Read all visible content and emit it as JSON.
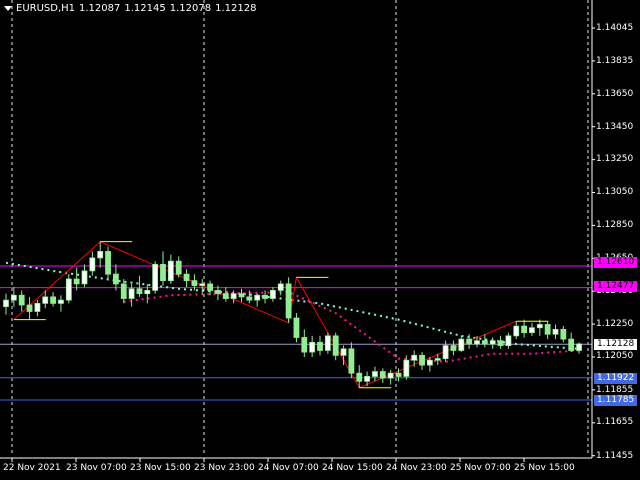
{
  "header": {
    "symbol": "EURUSD,H1",
    "open": "1.12087",
    "high": "1.12145",
    "low": "1.12078",
    "close": "1.12128"
  },
  "price_scale": [
    "1.14045",
    "1.13835",
    "1.13650",
    "1.13450",
    "1.13250",
    "1.13050",
    "1.12850",
    "1.12650",
    "1.12450",
    "1.12250",
    "1.12050",
    "1.11855",
    "1.11655",
    "1.11455"
  ],
  "time_scale": [
    "22 Nov 2021",
    "23 Nov 07:00",
    "23 Nov 15:00",
    "23 Nov 23:00",
    "24 Nov 07:00",
    "24 Nov 15:00",
    "24 Nov 23:00",
    "25 Nov 07:00",
    "25 Nov 15:00"
  ],
  "price_tags": [
    {
      "label": "1.12610",
      "bg": "#ff00ff",
      "fg": "#000000"
    },
    {
      "label": "1.12477",
      "bg": "#ff00ff",
      "fg": "#000000"
    },
    {
      "label": "1.12128",
      "bg": "#ffffff",
      "fg": "#000000"
    },
    {
      "label": "1.11922",
      "bg": "#4169e1",
      "fg": "#ffffff"
    },
    {
      "label": "1.11785",
      "bg": "#4169e1",
      "fg": "#ffffff"
    }
  ],
  "colors": {
    "bull": "#ffffff",
    "bear": "#90ee90",
    "candle_outline": "#90ee90",
    "zigzag": "#ff0000",
    "swing_level": "#ffff00",
    "ma_upper": "#7fffd4",
    "ma_lower": "#ff1493",
    "magenta_line": "#ff00ff",
    "blue_line": "#4169e1",
    "current_price_line": "#9aa0c8"
  },
  "chart_data": {
    "type": "candlestick",
    "symbol": "EURUSD",
    "timeframe": "H1",
    "ylim": [
      1.1144,
      1.1415
    ],
    "horizontal_levels": [
      1.1261,
      1.12477,
      1.12128,
      1.11922,
      1.11785
    ],
    "candles": [
      [
        1.1236,
        1.1244,
        1.1231,
        1.124
      ],
      [
        1.124,
        1.1248,
        1.1236,
        1.1243
      ],
      [
        1.1243,
        1.1246,
        1.1233,
        1.1237
      ],
      [
        1.1237,
        1.1242,
        1.1228,
        1.1233
      ],
      [
        1.1233,
        1.124,
        1.123,
        1.1238
      ],
      [
        1.1238,
        1.1246,
        1.1235,
        1.1242
      ],
      [
        1.1242,
        1.1245,
        1.1236,
        1.1238
      ],
      [
        1.1238,
        1.1243,
        1.1233,
        1.124
      ],
      [
        1.124,
        1.1256,
        1.1238,
        1.1253
      ],
      [
        1.1253,
        1.126,
        1.1246,
        1.125
      ],
      [
        1.125,
        1.1262,
        1.1248,
        1.1258
      ],
      [
        1.1258,
        1.127,
        1.1255,
        1.1266
      ],
      [
        1.1266,
        1.1276,
        1.126,
        1.127
      ],
      [
        1.127,
        1.1273,
        1.1252,
        1.1256
      ],
      [
        1.1256,
        1.1262,
        1.1246,
        1.125
      ],
      [
        1.125,
        1.1253,
        1.1238,
        1.1241
      ],
      [
        1.1241,
        1.125,
        1.1236,
        1.1247
      ],
      [
        1.1247,
        1.1255,
        1.1242,
        1.1244
      ],
      [
        1.1244,
        1.125,
        1.1238,
        1.1246
      ],
      [
        1.1246,
        1.1264,
        1.1244,
        1.1262
      ],
      [
        1.1262,
        1.127,
        1.1249,
        1.1252
      ],
      [
        1.1252,
        1.1268,
        1.125,
        1.1264
      ],
      [
        1.1264,
        1.1267,
        1.1254,
        1.1256
      ],
      [
        1.1256,
        1.1259,
        1.1248,
        1.1252
      ],
      [
        1.1252,
        1.1256,
        1.1246,
        1.1249
      ],
      [
        1.1249,
        1.1253,
        1.1244,
        1.125
      ],
      [
        1.125,
        1.1252,
        1.1243,
        1.1246
      ],
      [
        1.1246,
        1.1249,
        1.124,
        1.1244
      ],
      [
        1.1244,
        1.1248,
        1.1239,
        1.1241
      ],
      [
        1.1241,
        1.1246,
        1.1238,
        1.1244
      ],
      [
        1.1244,
        1.1247,
        1.1239,
        1.1242
      ],
      [
        1.1242,
        1.1246,
        1.1238,
        1.124
      ],
      [
        1.124,
        1.1244,
        1.1236,
        1.1243
      ],
      [
        1.1243,
        1.1246,
        1.1238,
        1.1241
      ],
      [
        1.1241,
        1.1248,
        1.1239,
        1.1246
      ],
      [
        1.1246,
        1.1252,
        1.1243,
        1.125
      ],
      [
        1.125,
        1.1254,
        1.1226,
        1.1229
      ],
      [
        1.1229,
        1.1232,
        1.1214,
        1.1217
      ],
      [
        1.1217,
        1.1222,
        1.1205,
        1.1208
      ],
      [
        1.1208,
        1.1218,
        1.1205,
        1.1214
      ],
      [
        1.1214,
        1.1218,
        1.1206,
        1.1209
      ],
      [
        1.1209,
        1.122,
        1.1207,
        1.1218
      ],
      [
        1.1218,
        1.122,
        1.1203,
        1.1206
      ],
      [
        1.1206,
        1.1212,
        1.12,
        1.121
      ],
      [
        1.121,
        1.1214,
        1.1192,
        1.1195
      ],
      [
        1.1195,
        1.12,
        1.1186,
        1.119
      ],
      [
        1.119,
        1.1196,
        1.1187,
        1.1193
      ],
      [
        1.1193,
        1.1199,
        1.119,
        1.1196
      ],
      [
        1.1196,
        1.1198,
        1.1189,
        1.1192
      ],
      [
        1.1192,
        1.1197,
        1.1188,
        1.1195
      ],
      [
        1.1195,
        1.1198,
        1.119,
        1.1193
      ],
      [
        1.1193,
        1.1206,
        1.1191,
        1.1203
      ],
      [
        1.1203,
        1.1209,
        1.1199,
        1.1206
      ],
      [
        1.1206,
        1.1208,
        1.1197,
        1.12
      ],
      [
        1.12,
        1.1205,
        1.1196,
        1.1203
      ],
      [
        1.1203,
        1.1207,
        1.12,
        1.1204
      ],
      [
        1.1204,
        1.1215,
        1.1202,
        1.1212
      ],
      [
        1.1212,
        1.1215,
        1.1206,
        1.1209
      ],
      [
        1.1209,
        1.1218,
        1.1208,
        1.1216
      ],
      [
        1.1216,
        1.1219,
        1.121,
        1.1213
      ],
      [
        1.1213,
        1.1218,
        1.1211,
        1.1215
      ],
      [
        1.1215,
        1.1219,
        1.1211,
        1.1213
      ],
      [
        1.1213,
        1.1217,
        1.121,
        1.1215
      ],
      [
        1.1215,
        1.1218,
        1.121,
        1.1212
      ],
      [
        1.1212,
        1.122,
        1.121,
        1.1218
      ],
      [
        1.1218,
        1.1227,
        1.1216,
        1.1224
      ],
      [
        1.1224,
        1.1228,
        1.1217,
        1.122
      ],
      [
        1.122,
        1.1226,
        1.1218,
        1.1223
      ],
      [
        1.1223,
        1.1228,
        1.1218,
        1.1225
      ],
      [
        1.1225,
        1.1227,
        1.1216,
        1.1219
      ],
      [
        1.1219,
        1.1225,
        1.1216,
        1.1222
      ],
      [
        1.1222,
        1.1224,
        1.1214,
        1.1216
      ],
      [
        1.1216,
        1.122,
        1.1208,
        1.1209
      ],
      [
        1.1209,
        1.1214,
        1.1207,
        1.1213
      ]
    ],
    "zigzag": [
      [
        1,
        1.1228
      ],
      [
        12,
        1.1276
      ],
      [
        36,
        1.1226
      ],
      [
        37,
        1.1254
      ],
      [
        45,
        1.1186
      ],
      [
        65,
        1.1227
      ]
    ],
    "swing_levels": [
      [
        1,
        1.1228
      ],
      [
        12,
        1.1276
      ],
      [
        37,
        1.1254
      ],
      [
        45,
        1.1186
      ],
      [
        65,
        1.1227
      ]
    ],
    "ma_upper": [
      [
        0,
        1.1263
      ],
      [
        6,
        1.1258
      ],
      [
        14,
        1.1252
      ],
      [
        22,
        1.1247
      ],
      [
        30,
        1.1244
      ],
      [
        40,
        1.1238
      ],
      [
        50,
        1.1228
      ],
      [
        58,
        1.1218
      ],
      [
        65,
        1.1213
      ],
      [
        70,
        1.1211
      ],
      [
        73,
        1.121
      ]
    ],
    "ma_lower": [
      [
        15,
        1.1239
      ],
      [
        21,
        1.1243
      ],
      [
        28,
        1.1244
      ],
      [
        36,
        1.1245
      ],
      [
        42,
        1.1232
      ],
      [
        50,
        1.1204
      ],
      [
        56,
        1.1202
      ],
      [
        62,
        1.1207
      ],
      [
        67,
        1.1207
      ],
      [
        73,
        1.1209
      ]
    ]
  }
}
